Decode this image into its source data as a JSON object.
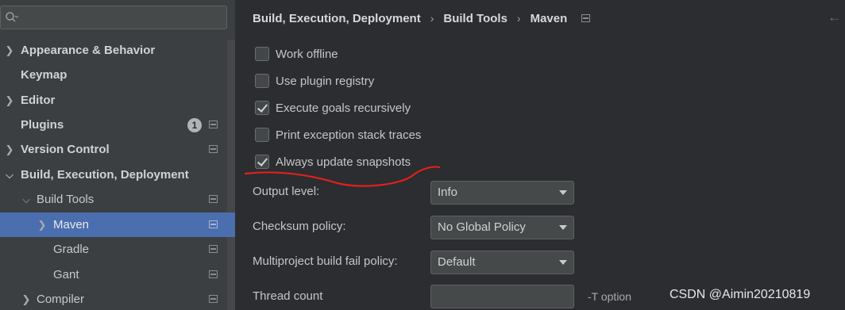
{
  "sidebar": {
    "search": {
      "placeholder": "",
      "value": ""
    },
    "items": [
      {
        "label": "Appearance & Behavior",
        "expandable": true,
        "expanded": false
      },
      {
        "label": "Keymap",
        "expandable": false
      },
      {
        "label": "Editor",
        "expandable": true,
        "expanded": false
      },
      {
        "label": "Plugins",
        "expandable": false,
        "badge": "1",
        "project_icon": true
      },
      {
        "label": "Version Control",
        "expandable": true,
        "expanded": false,
        "project_icon": true
      },
      {
        "label": "Build, Execution, Deployment",
        "expandable": true,
        "expanded": true
      },
      {
        "label": "Build Tools",
        "expandable": true,
        "expanded": true,
        "project_icon": true
      },
      {
        "label": "Maven",
        "expandable": true,
        "expanded": false,
        "selected": true,
        "project_icon": true
      },
      {
        "label": "Gradle",
        "expandable": false,
        "project_icon": true
      },
      {
        "label": "Gant",
        "expandable": false,
        "project_icon": true
      },
      {
        "label": "Compiler",
        "expandable": true,
        "expanded": false,
        "project_icon": true
      }
    ]
  },
  "breadcrumb": {
    "items": [
      "Build, Execution, Deployment",
      "Build Tools",
      "Maven"
    ],
    "separator": "›",
    "back_icon": "back-arrow-icon"
  },
  "options": {
    "checkboxes": [
      {
        "label": "Work offline",
        "checked": false
      },
      {
        "label": "Use plugin registry",
        "checked": false
      },
      {
        "label": "Execute goals recursively",
        "checked": true
      },
      {
        "label": "Print exception stack traces",
        "checked": false
      },
      {
        "label": "Always update snapshots",
        "checked": true
      }
    ],
    "output_level": {
      "label": "Output level:",
      "value": "Info"
    },
    "checksum_policy": {
      "label": "Checksum policy:",
      "value": "No Global Policy"
    },
    "fail_policy": {
      "label": "Multiproject build fail policy:",
      "value": "Default"
    },
    "thread_count": {
      "label": "Thread count",
      "value": "",
      "hint": "-T option"
    }
  },
  "watermark": "CSDN @Aimin20210819",
  "colors": {
    "sidebar_bg": "#3c3f41",
    "panel_bg": "#2b2d30",
    "selection": "#4b6eaf",
    "annotation_red": "#e0201e"
  }
}
